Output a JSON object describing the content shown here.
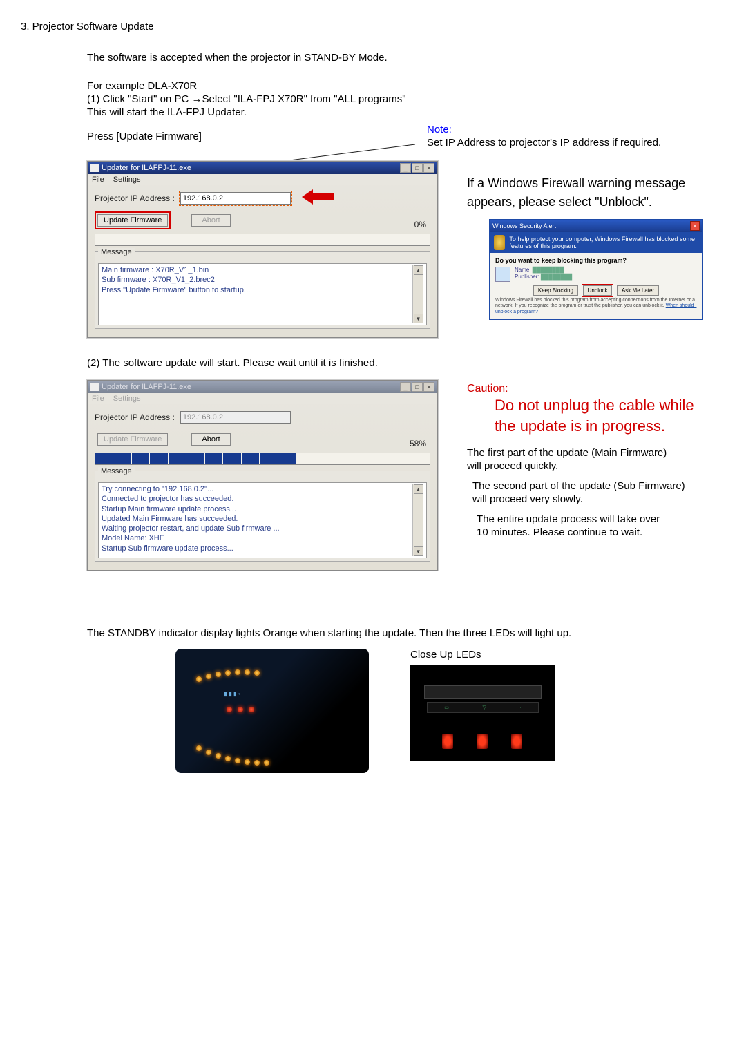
{
  "section": {
    "title": "3. Projector Software Update"
  },
  "intro": {
    "l1": "The software is accepted when the projector in STAND-BY Mode.",
    "l2": "For example DLA-X70R",
    "l3": "(1) Click \"Start\" on PC →Select \"ILA-FPJ X70R\" from \"ALL programs\"",
    "l4": "This will start the ILA-FPJ Updater.",
    "press": "Press [Update Firmware]",
    "note_label": "Note:",
    "note_text": "Set IP Address to projector's IP address if required."
  },
  "updater1": {
    "title": "Updater for ILAFPJ-11.exe",
    "menu_file": "File",
    "menu_settings": "Settings",
    "ip_label": "Projector IP Address :",
    "ip_value": "192.168.0.2",
    "btn_update": "Update Firmware",
    "btn_abort": "Abort",
    "progress": "0%",
    "message_label": "Message",
    "messages": [
      "Main firmware : X70R_V1_1.bin",
      "Sub firmware : X70R_V1_2.brec2",
      "Press \"Update Firmware\" button to startup..."
    ]
  },
  "firewall": {
    "line1": "If a Windows Firewall warning message",
    "line2": "appears, please select \"Unblock\".",
    "alert_title": "Windows Security Alert",
    "banner": "To help protect your computer, Windows Firewall has blocked some features of this program.",
    "q": "Do you want to keep blocking this program?",
    "name_label": "Name:",
    "pub_label": "Publisher:",
    "keep": "Keep Blocking",
    "unblock": "Unblock",
    "ask": "Ask Me Later",
    "foot": "Windows Firewall has blocked this program from accepting connections from the Internet or a network. If you recognize the program or trust the publisher, you can unblock it.",
    "foot_link": "When should I unblock a program?"
  },
  "step2": {
    "line": "(2) The software update will start.  Please wait until it is finished."
  },
  "updater2": {
    "title": "Updater for ILAFPJ-11.exe",
    "menu_file": "File",
    "menu_settings": "Settings",
    "ip_label": "Projector IP Address :",
    "ip_value": "192.168.0.2",
    "btn_update": "Update Firmware",
    "btn_abort": "Abort",
    "progress": "58%",
    "message_label": "Message",
    "messages": [
      "Try connecting to \"192.168.0.2\"...",
      "Connected to projector has succeeded.",
      "Startup Main firmware update process...",
      "Updated Main Firmware has succeeded.",
      "Waiting projector restart, and update Sub firmware ...",
      "Model Name: XHF",
      "Startup Sub firmware update process..."
    ]
  },
  "caution": {
    "title": "Caution:",
    "l1": "Do not unplug the cable while",
    "l2": "the update is in progress.",
    "n1": "The first part of the update (Main Firmware)",
    "n2": "will proceed quickly.",
    "n3": "The second part of the update (Sub Firmware)",
    "n4": "will proceed very slowly.",
    "n5": "The entire update process will take over",
    "n6": "10 minutes. Please continue to wait."
  },
  "standby": {
    "line": "The STANDBY indicator display lights Orange when starting the update. Then the three LEDs will light up.",
    "closeup": "Close Up LEDs"
  }
}
